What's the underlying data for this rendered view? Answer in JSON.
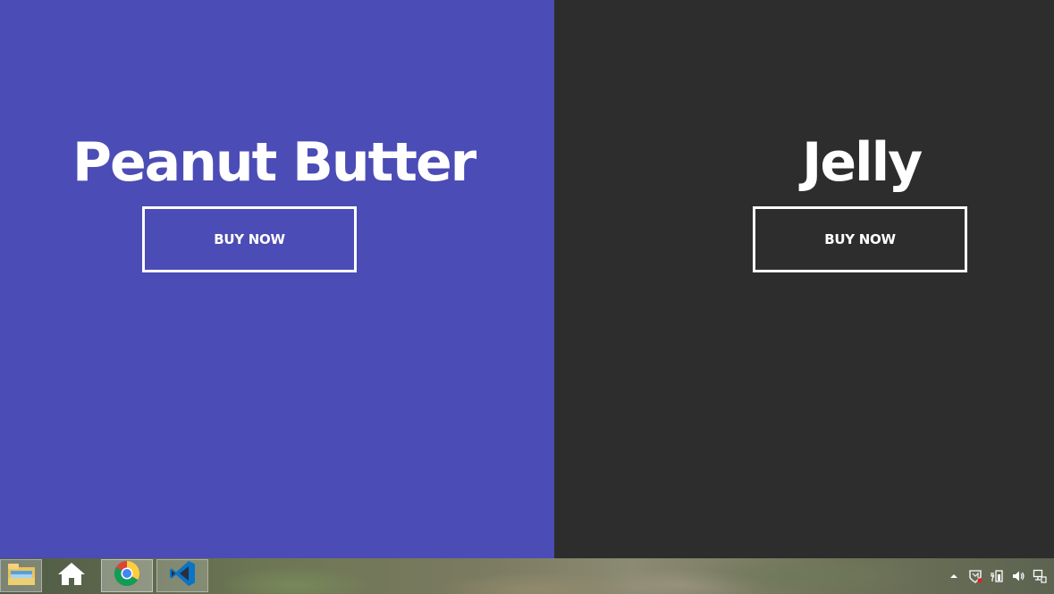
{
  "panels": {
    "left": {
      "title": "Peanut Butter",
      "button_label": "BUY NOW",
      "background": "#4b4cb5"
    },
    "right": {
      "title": "Jelly",
      "button_label": "BUY NOW",
      "background": "#2d2d2d"
    }
  },
  "taskbar": {
    "pinned": [
      {
        "icon": "file-explorer-icon"
      },
      {
        "icon": "home-icon"
      },
      {
        "icon": "chrome-icon"
      },
      {
        "icon": "vscode-icon"
      }
    ],
    "tray": [
      {
        "icon": "show-hidden-icons-chevron-icon"
      },
      {
        "icon": "security-shield-icon"
      },
      {
        "icon": "power-battery-icon"
      },
      {
        "icon": "volume-icon"
      },
      {
        "icon": "network-icon"
      }
    ]
  }
}
